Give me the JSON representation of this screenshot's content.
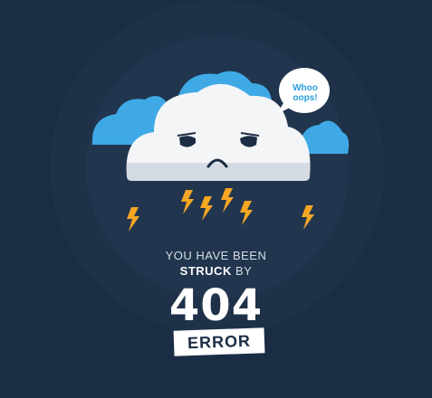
{
  "bubble": {
    "line1": "Whoo",
    "line2": "oops!"
  },
  "message": {
    "prefix": "YOU HAVE BEEN",
    "emphasis": "STRUCK",
    "suffix": "BY"
  },
  "error": {
    "code": "404",
    "label": "ERROR"
  },
  "colors": {
    "background": "#1b2d45",
    "cloud_blue": "#3fa9e6",
    "cloud_white": "#f4f5f7",
    "lightning": "#f5a623"
  },
  "icons": [
    "sad-cloud-icon",
    "speech-bubble-icon",
    "lightning-bolt-icon"
  ]
}
